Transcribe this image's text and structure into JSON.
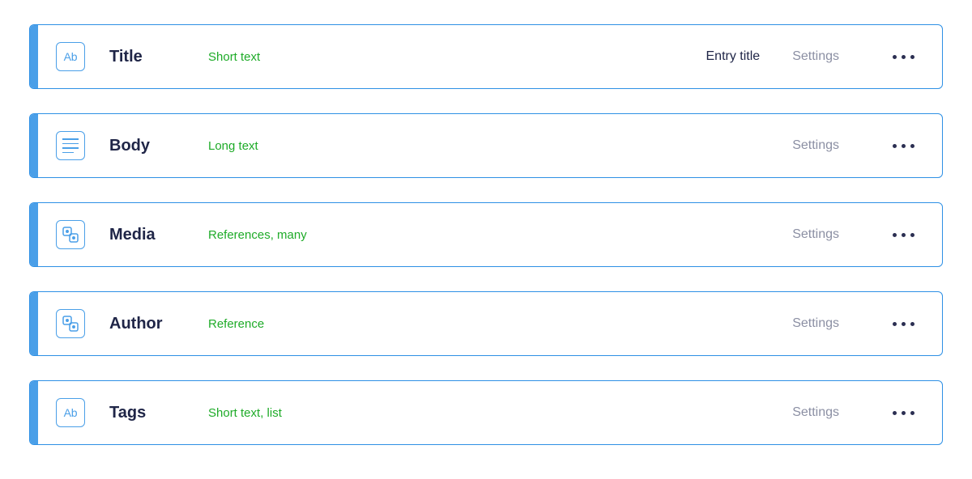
{
  "labels": {
    "settings": "Settings"
  },
  "fields": [
    {
      "icon": "text",
      "name": "Title",
      "type": "Short text",
      "badge": "Entry title"
    },
    {
      "icon": "long",
      "name": "Body",
      "type": "Long text",
      "badge": null
    },
    {
      "icon": "ref",
      "name": "Media",
      "type": "References, many",
      "badge": null
    },
    {
      "icon": "ref",
      "name": "Author",
      "type": "Reference",
      "badge": null
    },
    {
      "icon": "text",
      "name": "Tags",
      "type": "Short text, list",
      "badge": null
    }
  ]
}
